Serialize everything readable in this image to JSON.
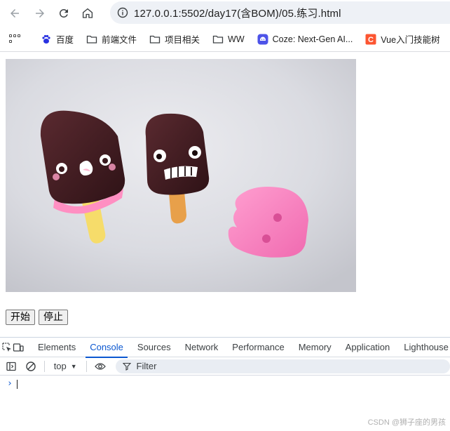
{
  "browser": {
    "url": "127.0.0.1:5502/day17(含BOM)/05.练习.html",
    "bookmarks": [
      {
        "label": "百度",
        "icon": "baidu-paw-icon"
      },
      {
        "label": "前端文件",
        "icon": "folder-icon"
      },
      {
        "label": "项目相关",
        "icon": "folder-icon"
      },
      {
        "label": "WW",
        "icon": "folder-icon"
      },
      {
        "label": "Coze: Next-Gen AI...",
        "icon": "coze-icon"
      },
      {
        "label": "Vue入门技能树",
        "icon": "csdn-c-icon"
      }
    ]
  },
  "page": {
    "image_alt": "popsicles",
    "start_button": "开始",
    "stop_button": "停止"
  },
  "devtools": {
    "tabs": [
      "Elements",
      "Console",
      "Sources",
      "Network",
      "Performance",
      "Memory",
      "Application",
      "Lighthouse"
    ],
    "active_tab": "Console",
    "context": "top",
    "filter_placeholder": "Filter",
    "prompt_symbol": "›"
  },
  "watermark": "CSDN @狮子座的男孩",
  "colors": {
    "accent": "#0b57d0",
    "omnibox": "#eef1f6",
    "csdn": "#fc5531",
    "coze": "#4d53e8"
  }
}
